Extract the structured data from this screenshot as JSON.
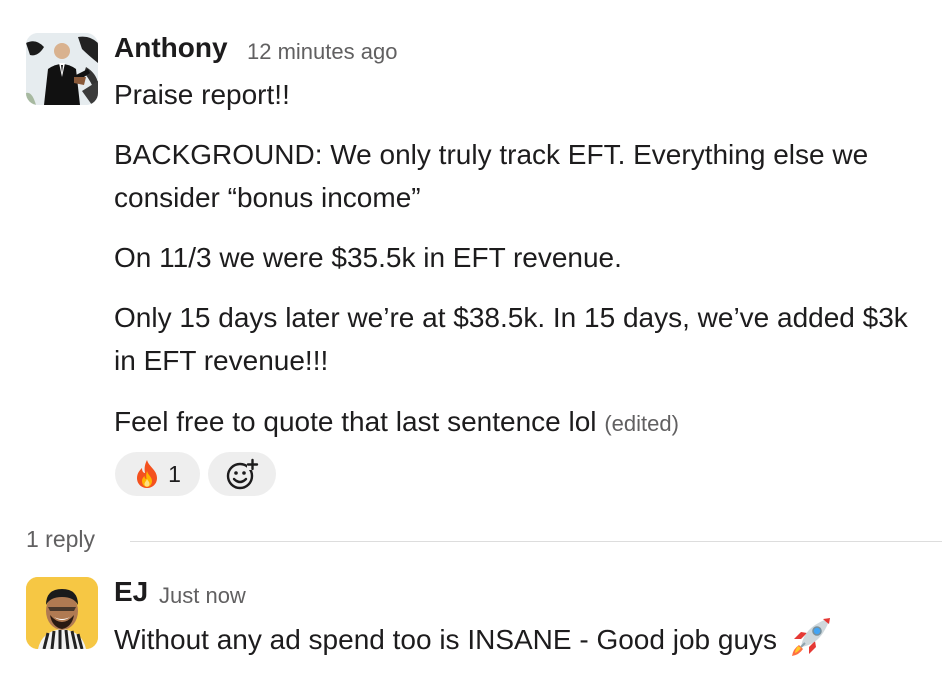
{
  "thread": {
    "parent": {
      "author": "Anthony",
      "timestamp": "12 minutes ago",
      "lines": {
        "l1": "Praise report!!",
        "l2": "BACKGROUND: We only truly track EFT. Everything else we",
        "l3": "consider “bonus income”",
        "l4": "On 11/3 we were $35.5k in EFT revenue.",
        "l5": "Only 15 days later we’re at $38.5k. In 15 days, we’ve added $3k",
        "l6": "in EFT revenue!!!",
        "l7": "Feel free to quote that last sentence lol"
      },
      "edited_label": "(edited)",
      "reactions": [
        {
          "icon": "fire-emoji",
          "count": "1"
        },
        {
          "icon": "add-reaction-icon"
        }
      ]
    },
    "reply_count": "1 reply",
    "reply": {
      "author": "EJ",
      "timestamp": "Just now",
      "text": "Without any ad spend too is INSANE - Good job guys",
      "emoji": "rocket-emoji"
    }
  },
  "colors": {
    "text": "#1d1c1d",
    "muted": "#616061",
    "reaction_bg": "#eeeeee",
    "ej_avatar_bg": "#f6c744"
  }
}
